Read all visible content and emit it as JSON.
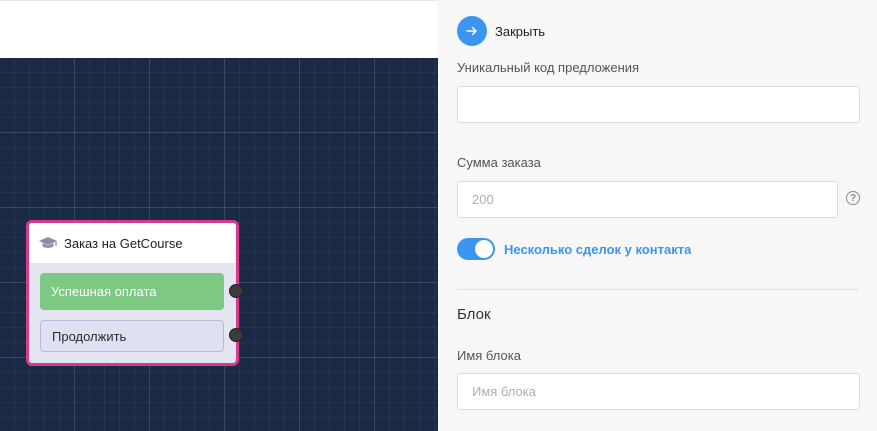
{
  "canvas": {
    "node": {
      "title": "Заказ на GetCourse",
      "icon": "graduation-cap-icon",
      "outputs": [
        {
          "label": "Успешная оплата",
          "color": "#7dc882"
        },
        {
          "label": "Продолжить",
          "color": "#dfe1f2"
        }
      ],
      "border_color": "#d63a8a"
    }
  },
  "panel": {
    "close_label": "Закрыть",
    "close_icon": "arrow-right-icon",
    "offer_code": {
      "label": "Уникальный код предложения",
      "value": "",
      "placeholder": ""
    },
    "order_sum": {
      "label": "Сумма заказа",
      "value": "",
      "placeholder": "200",
      "help_icon": "question-circle-icon"
    },
    "multiple_deals": {
      "label": "Несколько сделок у контакта",
      "enabled": true
    },
    "block_section": {
      "title": "Блок",
      "block_name": {
        "label": "Имя блока",
        "value": "",
        "placeholder": "Имя блока"
      }
    },
    "accent_color": "#3b95f1"
  }
}
